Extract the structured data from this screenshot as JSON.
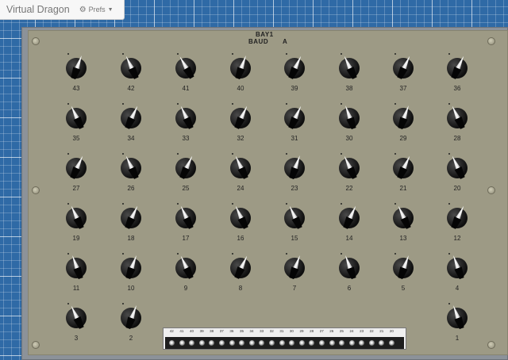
{
  "app": {
    "brand": "Virtual Dragon",
    "prefs_label": "Prefs",
    "prefs_icon": "gear-icon",
    "caret_icon": "caret-down-icon"
  },
  "panel": {
    "title": "BAY1",
    "baud_label": "BAUD",
    "baud_value": "A",
    "colors": {
      "background_grid": "#2f6aa6",
      "panel_face": "#9d9a85",
      "frame": "#8c9299",
      "knob": "#111111"
    }
  },
  "knobs": [
    {
      "label": "43",
      "angle": 20
    },
    {
      "label": "42",
      "angle": -25
    },
    {
      "label": "41",
      "angle": -30
    },
    {
      "label": "40",
      "angle": 20
    },
    {
      "label": "39",
      "angle": 25
    },
    {
      "label": "38",
      "angle": -25
    },
    {
      "label": "37",
      "angle": 25
    },
    {
      "label": "36",
      "angle": 25
    },
    {
      "label": "35",
      "angle": -25
    },
    {
      "label": "34",
      "angle": 25
    },
    {
      "label": "33",
      "angle": -25
    },
    {
      "label": "32",
      "angle": 25
    },
    {
      "label": "31",
      "angle": 25
    },
    {
      "label": "30",
      "angle": -20
    },
    {
      "label": "29",
      "angle": 20
    },
    {
      "label": "28",
      "angle": -25
    },
    {
      "label": "27",
      "angle": 25
    },
    {
      "label": "26",
      "angle": -25
    },
    {
      "label": "25",
      "angle": 25
    },
    {
      "label": "24",
      "angle": -25
    },
    {
      "label": "23",
      "angle": 20
    },
    {
      "label": "22",
      "angle": -25
    },
    {
      "label": "21",
      "angle": 25
    },
    {
      "label": "20",
      "angle": -25
    },
    {
      "label": "19",
      "angle": -25
    },
    {
      "label": "18",
      "angle": 25
    },
    {
      "label": "17",
      "angle": -25
    },
    {
      "label": "16",
      "angle": -25
    },
    {
      "label": "15",
      "angle": -25
    },
    {
      "label": "14",
      "angle": 25
    },
    {
      "label": "13",
      "angle": -25
    },
    {
      "label": "12",
      "angle": 25
    },
    {
      "label": "11",
      "angle": -20
    },
    {
      "label": "10",
      "angle": 20
    },
    {
      "label": "9",
      "angle": -25
    },
    {
      "label": "8",
      "angle": 25
    },
    {
      "label": "7",
      "angle": 20
    },
    {
      "label": "6",
      "angle": -20
    },
    {
      "label": "5",
      "angle": 20
    },
    {
      "label": "4",
      "angle": -20
    },
    {
      "label": "3",
      "angle": -25
    },
    {
      "label": "2",
      "angle": 20
    },
    {
      "label": "1",
      "angle": -20
    }
  ],
  "plugboard": {
    "labels": [
      "42",
      "41",
      "40",
      "39",
      "38",
      "37",
      "36",
      "35",
      "34",
      "33",
      "32",
      "31",
      "30",
      "29",
      "28",
      "27",
      "26",
      "25",
      "24",
      "23",
      "22",
      "21",
      "20"
    ]
  }
}
